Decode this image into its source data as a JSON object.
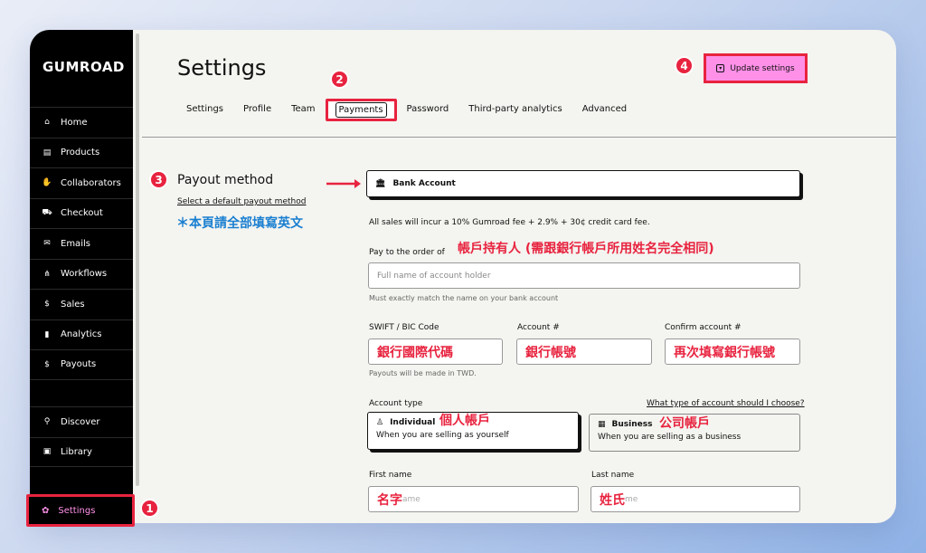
{
  "sidebar": {
    "logo": "GUMROAD",
    "items": [
      {
        "label": "Home",
        "icon": "home-icon"
      },
      {
        "label": "Products",
        "icon": "archive-icon"
      },
      {
        "label": "Collaborators",
        "icon": "handshake-icon"
      },
      {
        "label": "Checkout",
        "icon": "cart-icon"
      },
      {
        "label": "Emails",
        "icon": "envelope-icon"
      },
      {
        "label": "Workflows",
        "icon": "flow-icon"
      },
      {
        "label": "Sales",
        "icon": "dollar-circle-icon"
      },
      {
        "label": "Analytics",
        "icon": "bar-chart-icon"
      },
      {
        "label": "Payouts",
        "icon": "dollar-circle-icon"
      }
    ],
    "bottom_items": [
      {
        "label": "Discover",
        "icon": "search-icon"
      },
      {
        "label": "Library",
        "icon": "bookmark-icon"
      }
    ],
    "settings_label": "Settings"
  },
  "header": {
    "title": "Settings",
    "update_button": "Update settings",
    "tabs": [
      "Settings",
      "Profile",
      "Team",
      "Payments",
      "Password",
      "Third-party analytics",
      "Advanced"
    ],
    "active_tab": "Payments"
  },
  "badges": {
    "one": "1",
    "two": "2",
    "three": "3",
    "four": "4"
  },
  "payout": {
    "section_title": "Payout method",
    "section_link": "Select a default payout method",
    "annot_english": "＊本頁請全部填寫英文",
    "method": "Bank Account",
    "fee_note": "All sales will incur a 10% Gumroad fee + 2.9% + 30¢ credit card fee.",
    "pay_to_label": "Pay to the order of",
    "pay_to_annot": "帳戶持有人 (需跟銀行帳戶所用姓名完全相同)",
    "pay_to_placeholder": "Full name of account holder",
    "pay_to_hint": "Must exactly match the name on your bank account",
    "swift_label": "SWIFT / BIC Code",
    "swift_annot": "銀行國際代碼",
    "account_label": "Account #",
    "account_annot": "銀行帳號",
    "confirm_label": "Confirm account #",
    "confirm_annot": "再次填寫銀行帳號",
    "currency_hint": "Payouts will be made in TWD.",
    "account_type_label": "Account type",
    "account_type_help": "What type of account should I choose?",
    "individual_title": "Individual",
    "individual_annot": "個人帳戶",
    "individual_sub": "When you are selling as yourself",
    "business_title": "Business",
    "business_annot": "公司帳戶",
    "business_sub": "When you are selling as a business",
    "first_name_label": "First name",
    "first_name_annot": "名字",
    "first_name_ghost": "ame",
    "last_name_label": "Last name",
    "last_name_annot": "姓氏",
    "last_name_ghost": "me"
  },
  "colors": {
    "accent_pink": "#ff90e8",
    "annotation_red": "#e8233f",
    "annotation_blue": "#1a7fd1"
  }
}
